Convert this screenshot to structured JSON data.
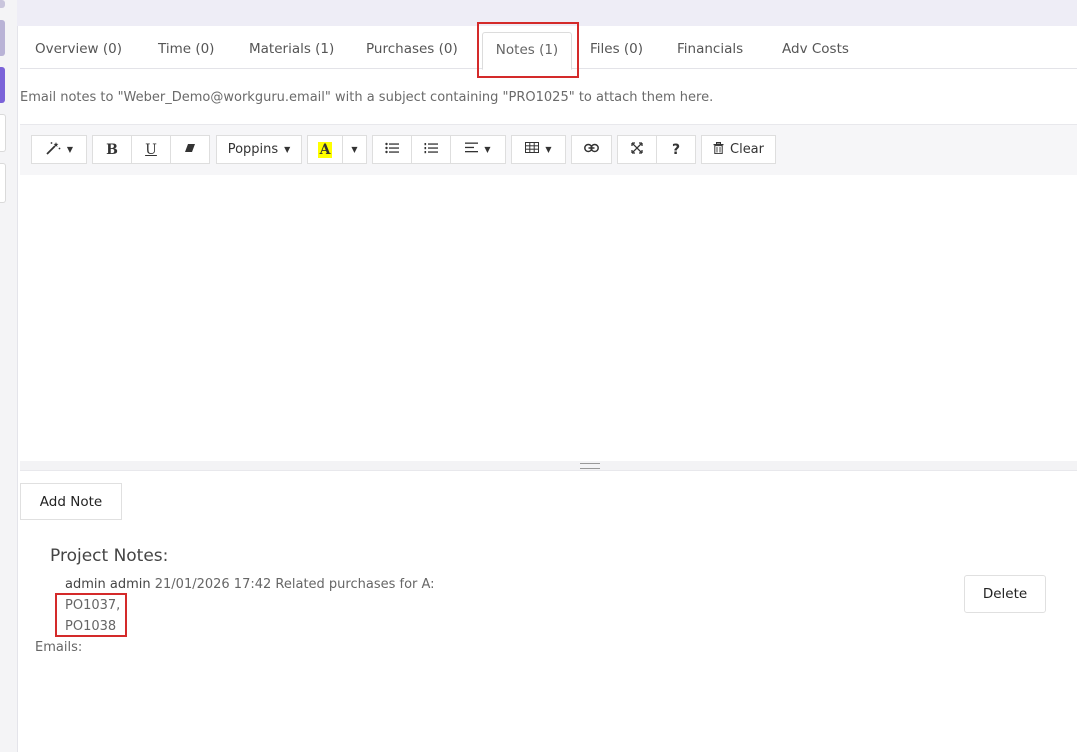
{
  "tabs": [
    {
      "label": "Overview (0)"
    },
    {
      "label": "Time (0)"
    },
    {
      "label": "Materials (1)"
    },
    {
      "label": "Purchases (0)"
    },
    {
      "label": "Notes (1)",
      "active": true
    },
    {
      "label": "Files (0)"
    },
    {
      "label": "Financials"
    },
    {
      "label": "Adv Costs"
    }
  ],
  "email_hint": "Email notes to \"Weber_Demo@workguru.email\" with a subject containing \"PRO1025\" to attach them here.",
  "toolbar": {
    "magic_icon": "magic-wand-icon",
    "bold": "B",
    "underline": "U",
    "eraser_icon": "eraser-icon",
    "font_name": "Poppins",
    "highlight_letter": "A",
    "highlight_color": "#ffff00",
    "ul_icon": "unordered-list-icon",
    "ol_icon": "ordered-list-icon",
    "align_icon": "align-icon",
    "table_icon": "table-icon",
    "link_icon": "link-icon",
    "fullscreen_icon": "fullscreen-icon",
    "help": "?",
    "clear_label": "Clear"
  },
  "add_note_label": "Add Note",
  "notes": {
    "title": "Project Notes:",
    "items": [
      {
        "author": "admin admin",
        "timestamp": "21/01/2026 17:42",
        "text": "Related purchases for A:",
        "refs": [
          "PO1037,",
          "PO1038"
        ],
        "delete_label": "Delete"
      }
    ]
  },
  "emails_label": "Emails:",
  "colors": {
    "highlight_red": "#d42a2a",
    "sidebar_purple": "#7b63d8",
    "sidebar_lavender": "#b9b3d6",
    "top_band": "#eeedf6"
  }
}
